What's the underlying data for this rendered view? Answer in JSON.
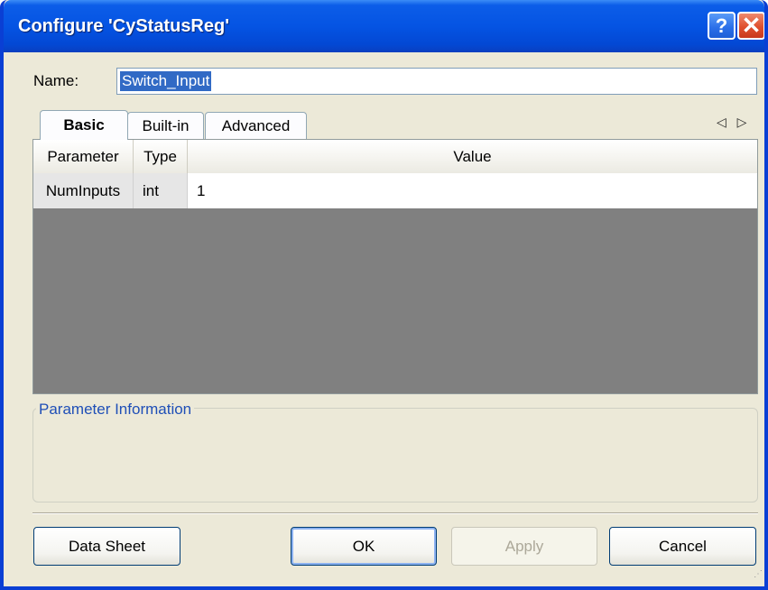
{
  "window": {
    "title": "Configure 'CyStatusReg'"
  },
  "titlebar": {
    "help": "?",
    "close": "✕"
  },
  "name": {
    "label": "Name:",
    "value": "Switch_Input"
  },
  "tabs": [
    {
      "label": "Basic",
      "active": true
    },
    {
      "label": "Built-in",
      "active": false
    },
    {
      "label": "Advanced",
      "active": false
    }
  ],
  "tab_nav": {
    "arrows": "◁ ▷"
  },
  "grid": {
    "columns": [
      "Parameter",
      "Type",
      "Value"
    ],
    "rows": [
      {
        "parameter": "NumInputs",
        "type": "int",
        "value": "1"
      }
    ]
  },
  "info": {
    "legend": "Parameter Information"
  },
  "buttons": {
    "data_sheet": "Data Sheet",
    "ok": "OK",
    "apply": "Apply",
    "cancel": "Cancel"
  }
}
